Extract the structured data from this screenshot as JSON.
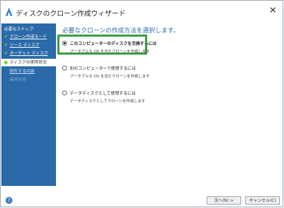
{
  "window": {
    "title": "ディスクのクローン作成ウィザード",
    "close_glyph": "✕"
  },
  "sidebar": {
    "heading": "必要なステップ:",
    "steps": [
      {
        "label": "クローン作成モード",
        "state": "done"
      },
      {
        "label": "ソース ディスク",
        "state": "done"
      },
      {
        "label": "ターゲット ディスク",
        "state": "done"
      },
      {
        "label": "ディスクの使用状況",
        "state": "current"
      },
      {
        "label": "除外する内容",
        "state": "link"
      },
      {
        "label": "最終処理",
        "state": "future"
      }
    ],
    "check_glyph": "✔"
  },
  "main": {
    "heading": "必要なクローンの作成方法を選択します。",
    "options": [
      {
        "title": "このコンピューターのディスクを交換するには",
        "desc": "ブータブルな OS を含むクローンを作成します",
        "selected": true
      },
      {
        "title": "別のコンピューターで使用するには",
        "desc": "ブータブルな OS を含むクローンを作成します",
        "selected": false
      },
      {
        "title": "データディスクとして使用するには",
        "desc": "データディスクとしてクローンを作成します",
        "selected": false
      }
    ]
  },
  "footer": {
    "help_glyph": "?",
    "next_label": "次へ(N) >",
    "cancel_label": "キャンセル(C)"
  },
  "colors": {
    "sidebar_bg": "#2a6aa9",
    "accent_check": "#7ed321",
    "highlight_frame": "#3a9b3e"
  },
  "icons": {
    "title": "acronis-logo-icon",
    "close": "close-icon",
    "help": "help-icon"
  }
}
